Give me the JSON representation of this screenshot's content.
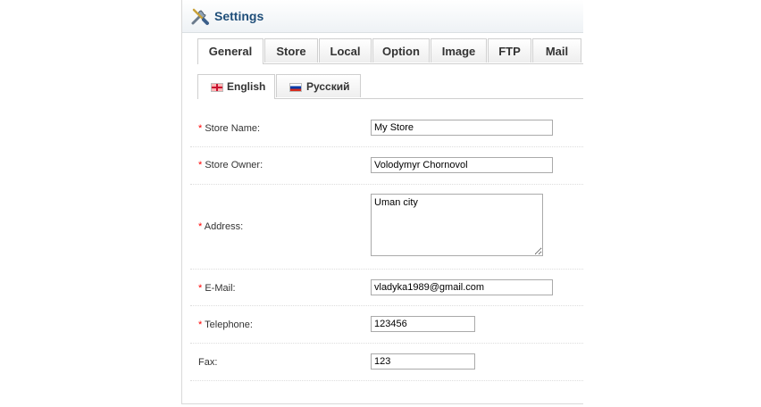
{
  "heading": {
    "title": "Settings",
    "icon": "settings-tools-icon"
  },
  "tabs": [
    {
      "label": "General",
      "active": true
    },
    {
      "label": "Store",
      "active": false
    },
    {
      "label": "Local",
      "active": false
    },
    {
      "label": "Option",
      "active": false
    },
    {
      "label": "Image",
      "active": false
    },
    {
      "label": "FTP",
      "active": false
    },
    {
      "label": "Mail",
      "active": false
    }
  ],
  "language_tabs": [
    {
      "label": "English",
      "flag": "uk-flag-icon",
      "active": true
    },
    {
      "label": "Русский",
      "flag": "russia-flag-icon",
      "active": false
    }
  ],
  "form": {
    "required_mark": "*",
    "store_name": {
      "label": "Store Name:",
      "value": "My Store",
      "required": true
    },
    "store_owner": {
      "label": "Store Owner:",
      "value": "Volodymyr Chornovol",
      "required": true
    },
    "address": {
      "label": "Address:",
      "value": "Uman city",
      "required": true
    },
    "email": {
      "label": "E-Mail:",
      "value": "vladyka1989@gmail.com",
      "required": true
    },
    "telephone": {
      "label": "Telephone:",
      "value": "123456",
      "required": true
    },
    "fax": {
      "label": "Fax:",
      "value": "123",
      "required": false
    }
  },
  "colors": {
    "title": "#1f4e79",
    "required": "#ff0000",
    "border": "#cfcfcf"
  }
}
